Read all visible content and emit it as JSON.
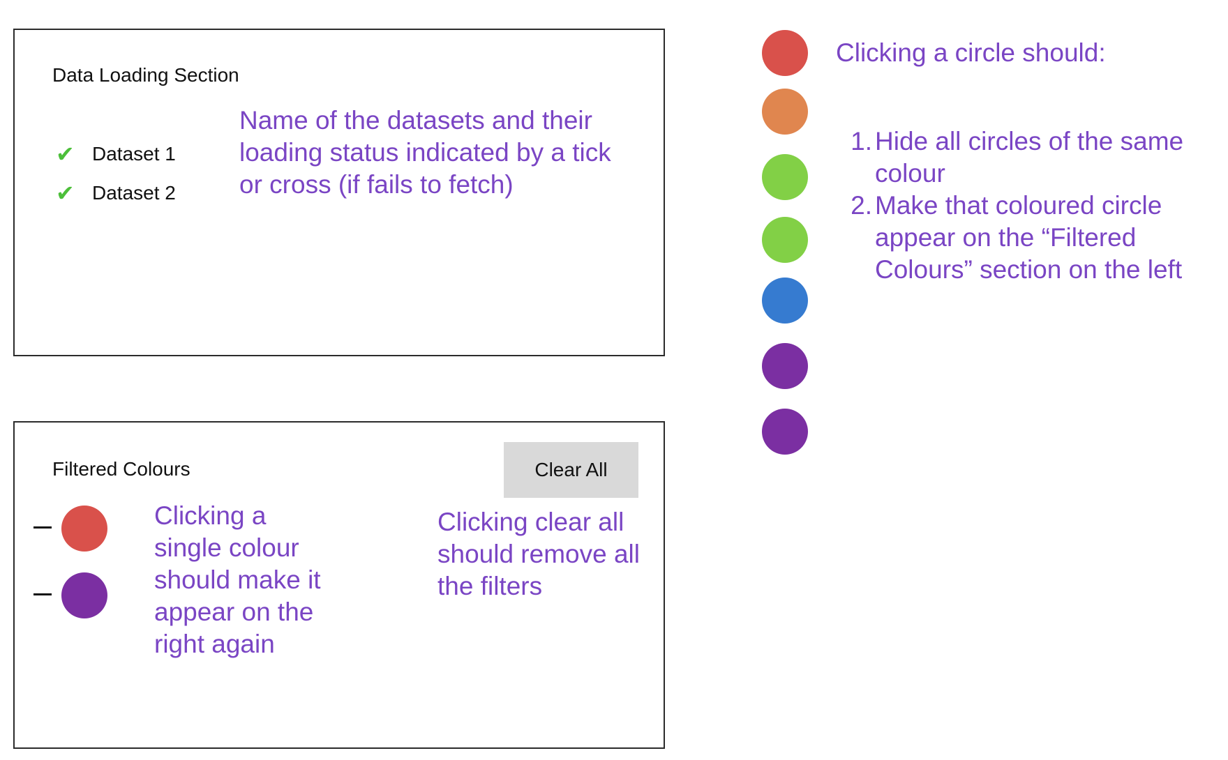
{
  "data_loading": {
    "title": "Data Loading Section",
    "datasets": [
      {
        "name": "Dataset 1",
        "status": "loaded",
        "icon": "check-icon"
      },
      {
        "name": "Dataset 2",
        "status": "loaded",
        "icon": "check-icon"
      }
    ],
    "note": "Name of the datasets and their loading status indicated by a tick or cross (if fails to fetch)"
  },
  "filtered": {
    "title": "Filtered Colours",
    "clear_label": "Clear All",
    "colours": [
      "#d9514b",
      "#7b2fa2"
    ],
    "note": "Clicking a single colour should make it appear on the right again",
    "clear_note": "Clicking clear all should remove all the filters"
  },
  "circles": {
    "colours": [
      "#d9514b",
      "#e0864f",
      "#82d046",
      "#82d046",
      "#367bd0",
      "#7b2fa2",
      "#7b2fa2"
    ],
    "heading": "Clicking a circle should:",
    "steps": [
      {
        "num": "1.",
        "text": "Hide all circles of the same colour"
      },
      {
        "num": "2.",
        "text": "Make that coloured circle appear on the “Filtered Colours” section on the left"
      }
    ]
  },
  "colors": {
    "annotation": "#7a45c4",
    "check": "#4cbf3a"
  }
}
